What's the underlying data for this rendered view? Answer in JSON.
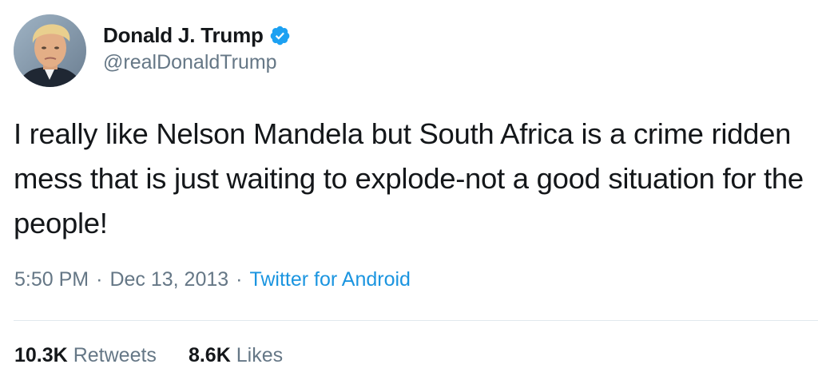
{
  "author": {
    "display_name": "Donald J. Trump",
    "handle": "@realDonaldTrump",
    "verified": true,
    "avatar_icon": "profile-photo",
    "verified_icon": "verified-badge-icon"
  },
  "tweet": {
    "text": "I really like Nelson Mandela but South Africa is a crime ridden mess that is just waiting to explode-not a good situation for the people!",
    "time": "5:50 PM",
    "separator": "·",
    "date": "Dec 13, 2013",
    "source": "Twitter for Android"
  },
  "stats": {
    "retweets_count": "10.3K",
    "retweets_label": "Retweets",
    "likes_count": "8.6K",
    "likes_label": "Likes"
  },
  "colors": {
    "text": "#14171a",
    "secondary": "#657786",
    "link": "#1b95e0",
    "verified": "#1da1f2",
    "divider": "#e1e8ed"
  }
}
